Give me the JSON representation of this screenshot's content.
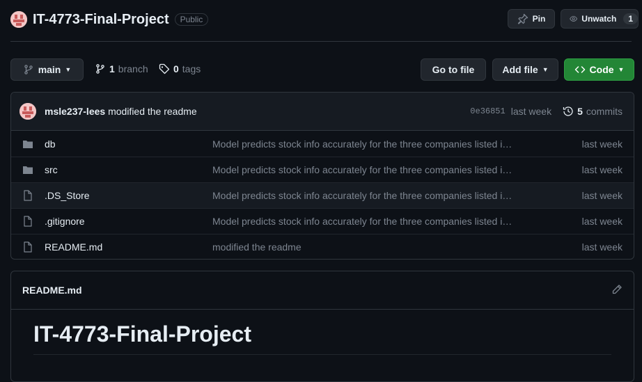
{
  "repo": {
    "name": "IT-4773-Final-Project",
    "visibility": "Public"
  },
  "actions": {
    "pin_label": "Pin",
    "unwatch_label": "Unwatch",
    "watch_count": "1"
  },
  "toolbar": {
    "branch_label": "main",
    "branch_count": "1",
    "branch_word": "branch",
    "tag_count": "0",
    "tag_word": "tags",
    "go_to_file_label": "Go to file",
    "add_file_label": "Add file",
    "code_label": "Code"
  },
  "latest_commit": {
    "author": "msle237-lees",
    "message": "modified the readme",
    "sha": "0e36851",
    "time": "last week",
    "commit_count": "5",
    "commit_word": "commits"
  },
  "files": [
    {
      "name": "db",
      "type": "folder",
      "message": "Model predicts stock info accurately for the three companies listed i…",
      "time": "last week"
    },
    {
      "name": "src",
      "type": "folder",
      "message": "Model predicts stock info accurately for the three companies listed i…",
      "time": "last week"
    },
    {
      "name": ".DS_Store",
      "type": "file",
      "message": "Model predicts stock info accurately for the three companies listed i…",
      "time": "last week"
    },
    {
      "name": ".gitignore",
      "type": "file",
      "message": "Model predicts stock info accurately for the three companies listed i…",
      "time": "last week"
    },
    {
      "name": "README.md",
      "type": "file",
      "message": "modified the readme",
      "time": "last week"
    }
  ],
  "readme": {
    "filename": "README.md",
    "heading": "IT-4773-Final-Project"
  },
  "colors": {
    "background": "#0d1117",
    "border": "#30363d",
    "green_button": "#238636",
    "muted_text": "#7d8590"
  }
}
